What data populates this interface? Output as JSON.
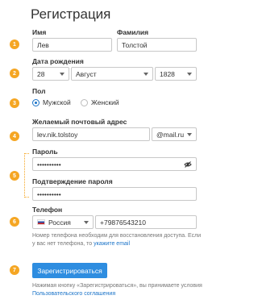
{
  "form": {
    "title": "Регистрация",
    "first_name": {
      "label": "Имя",
      "value": "Лев"
    },
    "last_name": {
      "label": "Фамилия",
      "value": "Толстой"
    },
    "birth_date": {
      "label": "Дата рождения",
      "day": "28",
      "month": "Август",
      "year": "1828"
    },
    "gender": {
      "label": "Пол",
      "male": "Мужской",
      "female": "Женский",
      "selected": "male"
    },
    "email": {
      "label": "Желаемый почтовый адрес",
      "value": "lev.nik.tolstoy",
      "domain": "@mail.ru"
    },
    "password": {
      "label": "Пароль",
      "value": "••••••••••"
    },
    "password_confirm": {
      "label": "Подтверждение пароля",
      "value": "••••••••••"
    },
    "phone": {
      "label": "Телефон",
      "country": "Россия",
      "number": "+79876543210",
      "hint_text": "Номер телефона необходим для восстановления доступа. Если у вас нет телефона, то",
      "hint_link": "укажите email"
    },
    "submit_label": "Зарегистрироваться",
    "terms_text": "Нажимая кнопку «Зарегистрироваться», вы принимаете условия",
    "terms_link": "Пользовательского соглашения"
  },
  "markers": [
    "1",
    "2",
    "3",
    "4",
    "5",
    "6",
    "7"
  ],
  "colors": {
    "marker": "#f5a623",
    "accent": "#1a73c8",
    "button": "#2e8de0"
  }
}
